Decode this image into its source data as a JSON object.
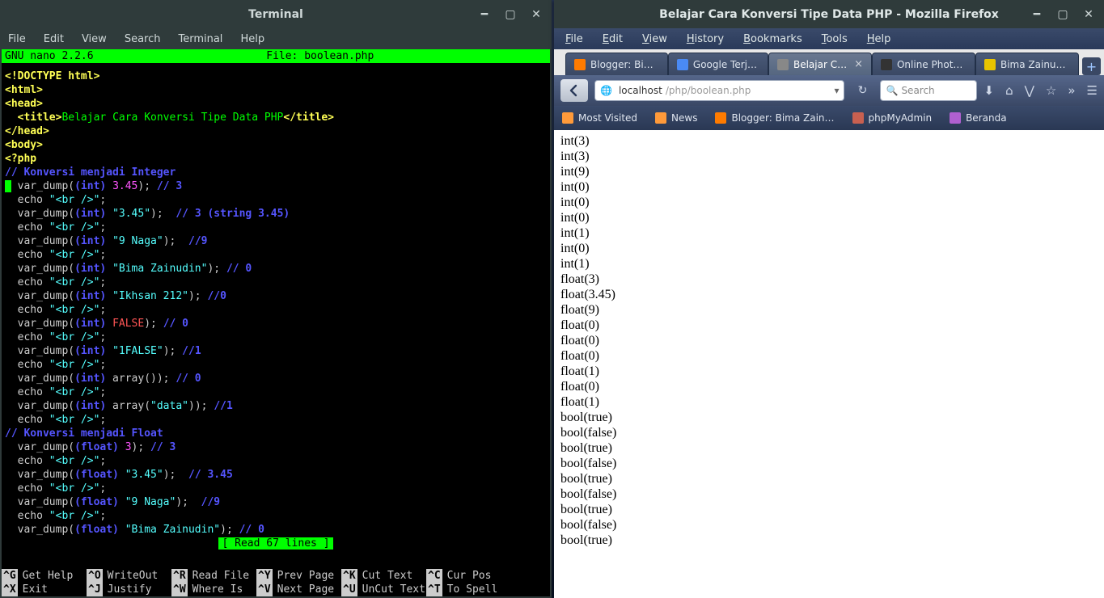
{
  "terminal": {
    "title": "Terminal",
    "menus": [
      "File",
      "Edit",
      "View",
      "Search",
      "Terminal",
      "Help"
    ],
    "nano": {
      "version": "GNU nano 2.2.6",
      "file_label": "File: boolean.php",
      "status": "[ Read 67 lines ]",
      "shortcuts_row1": [
        {
          "k": "^G",
          "l": "Get Help"
        },
        {
          "k": "^O",
          "l": "WriteOut"
        },
        {
          "k": "^R",
          "l": "Read File"
        },
        {
          "k": "^Y",
          "l": "Prev Page"
        },
        {
          "k": "^K",
          "l": "Cut Text"
        },
        {
          "k": "^C",
          "l": "Cur Pos"
        }
      ],
      "shortcuts_row2": [
        {
          "k": "^X",
          "l": "Exit"
        },
        {
          "k": "^J",
          "l": "Justify"
        },
        {
          "k": "^W",
          "l": "Where Is"
        },
        {
          "k": "^V",
          "l": "Next Page"
        },
        {
          "k": "^U",
          "l": "UnCut Text"
        },
        {
          "k": "^T",
          "l": "To Spell"
        }
      ]
    },
    "code_lines": [
      [
        {
          "c": "c-y",
          "t": "<!DOCTYPE html>"
        }
      ],
      [
        {
          "c": "c-y",
          "t": "<html>"
        }
      ],
      [
        {
          "c": "c-y",
          "t": "<head>"
        }
      ],
      [
        {
          "c": "c-w",
          "t": "  "
        },
        {
          "c": "c-y",
          "t": "<title>"
        },
        {
          "c": "c-g",
          "t": "Belajar Cara Konversi Tipe Data PHP"
        },
        {
          "c": "c-y",
          "t": "</title>"
        }
      ],
      [
        {
          "c": "c-y",
          "t": "</head>"
        }
      ],
      [
        {
          "c": "c-y",
          "t": "<body>"
        }
      ],
      [
        {
          "c": "c-y",
          "t": "<?php"
        }
      ],
      [
        {
          "c": "c-c",
          "t": "// Konversi menjadi Integer"
        }
      ],
      [
        {
          "c": "cur",
          "t": " "
        },
        {
          "c": "c-w",
          "t": " var_dump("
        },
        {
          "c": "c-c",
          "t": "(int)"
        },
        {
          "c": "c-w",
          "t": " "
        },
        {
          "c": "c-m",
          "t": "3.45"
        },
        {
          "c": "c-w",
          "t": "); "
        },
        {
          "c": "c-c",
          "t": "// 3"
        }
      ],
      [
        {
          "c": "c-w",
          "t": "  echo "
        },
        {
          "c": "c-cy",
          "t": "\"<br />\""
        },
        {
          "c": "c-w",
          "t": ";"
        }
      ],
      [
        {
          "c": "c-w",
          "t": "  var_dump("
        },
        {
          "c": "c-c",
          "t": "(int)"
        },
        {
          "c": "c-w",
          "t": " "
        },
        {
          "c": "c-cy",
          "t": "\"3.45\""
        },
        {
          "c": "c-w",
          "t": ");  "
        },
        {
          "c": "c-c",
          "t": "// 3 (string 3.45)"
        }
      ],
      [
        {
          "c": "c-w",
          "t": "  echo "
        },
        {
          "c": "c-cy",
          "t": "\"<br />\""
        },
        {
          "c": "c-w",
          "t": ";"
        }
      ],
      [
        {
          "c": "c-w",
          "t": "  var_dump("
        },
        {
          "c": "c-c",
          "t": "(int)"
        },
        {
          "c": "c-w",
          "t": " "
        },
        {
          "c": "c-cy",
          "t": "\"9 Naga\""
        },
        {
          "c": "c-w",
          "t": ");  "
        },
        {
          "c": "c-c",
          "t": "//9"
        }
      ],
      [
        {
          "c": "c-w",
          "t": "  echo "
        },
        {
          "c": "c-cy",
          "t": "\"<br />\""
        },
        {
          "c": "c-w",
          "t": ";"
        }
      ],
      [
        {
          "c": "c-w",
          "t": "  var_dump("
        },
        {
          "c": "c-c",
          "t": "(int)"
        },
        {
          "c": "c-w",
          "t": " "
        },
        {
          "c": "c-cy",
          "t": "\"Bima Zainudin\""
        },
        {
          "c": "c-w",
          "t": "); "
        },
        {
          "c": "c-c",
          "t": "// 0"
        }
      ],
      [
        {
          "c": "c-w",
          "t": "  echo "
        },
        {
          "c": "c-cy",
          "t": "\"<br />\""
        },
        {
          "c": "c-w",
          "t": ";"
        }
      ],
      [
        {
          "c": "c-w",
          "t": "  var_dump("
        },
        {
          "c": "c-c",
          "t": "(int)"
        },
        {
          "c": "c-w",
          "t": " "
        },
        {
          "c": "c-cy",
          "t": "\"Ikhsan 212\""
        },
        {
          "c": "c-w",
          "t": "); "
        },
        {
          "c": "c-c",
          "t": "//0"
        }
      ],
      [
        {
          "c": "c-w",
          "t": "  echo "
        },
        {
          "c": "c-cy",
          "t": "\"<br />\""
        },
        {
          "c": "c-w",
          "t": ";"
        }
      ],
      [
        {
          "c": "c-w",
          "t": "  var_dump("
        },
        {
          "c": "c-c",
          "t": "(int)"
        },
        {
          "c": "c-w",
          "t": " "
        },
        {
          "c": "c-r",
          "t": "FALSE"
        },
        {
          "c": "c-w",
          "t": "); "
        },
        {
          "c": "c-c",
          "t": "// 0"
        }
      ],
      [
        {
          "c": "c-w",
          "t": "  echo "
        },
        {
          "c": "c-cy",
          "t": "\"<br />\""
        },
        {
          "c": "c-w",
          "t": ";"
        }
      ],
      [
        {
          "c": "c-w",
          "t": "  var_dump("
        },
        {
          "c": "c-c",
          "t": "(int)"
        },
        {
          "c": "c-w",
          "t": " "
        },
        {
          "c": "c-cy",
          "t": "\"1FALSE\""
        },
        {
          "c": "c-w",
          "t": "); "
        },
        {
          "c": "c-c",
          "t": "//1"
        }
      ],
      [
        {
          "c": "c-w",
          "t": "  echo "
        },
        {
          "c": "c-cy",
          "t": "\"<br />\""
        },
        {
          "c": "c-w",
          "t": ";"
        }
      ],
      [
        {
          "c": "c-w",
          "t": "  var_dump("
        },
        {
          "c": "c-c",
          "t": "(int)"
        },
        {
          "c": "c-w",
          "t": " array()); "
        },
        {
          "c": "c-c",
          "t": "// 0"
        }
      ],
      [
        {
          "c": "c-w",
          "t": "  echo "
        },
        {
          "c": "c-cy",
          "t": "\"<br />\""
        },
        {
          "c": "c-w",
          "t": ";"
        }
      ],
      [
        {
          "c": "c-w",
          "t": "  var_dump("
        },
        {
          "c": "c-c",
          "t": "(int)"
        },
        {
          "c": "c-w",
          "t": " array("
        },
        {
          "c": "c-cy",
          "t": "\"data\""
        },
        {
          "c": "c-w",
          "t": ")); "
        },
        {
          "c": "c-c",
          "t": "//1"
        }
      ],
      [
        {
          "c": "c-w",
          "t": "  echo "
        },
        {
          "c": "c-cy",
          "t": "\"<br />\""
        },
        {
          "c": "c-w",
          "t": ";"
        }
      ],
      [
        {
          "c": "c-c",
          "t": "// Konversi menjadi Float"
        }
      ],
      [
        {
          "c": "c-w",
          "t": "  var_dump("
        },
        {
          "c": "c-c",
          "t": "(float)"
        },
        {
          "c": "c-w",
          "t": " "
        },
        {
          "c": "c-m",
          "t": "3"
        },
        {
          "c": "c-w",
          "t": "); "
        },
        {
          "c": "c-c",
          "t": "// 3"
        }
      ],
      [
        {
          "c": "c-w",
          "t": "  echo "
        },
        {
          "c": "c-cy",
          "t": "\"<br />\""
        },
        {
          "c": "c-w",
          "t": ";"
        }
      ],
      [
        {
          "c": "c-w",
          "t": "  var_dump("
        },
        {
          "c": "c-c",
          "t": "(float)"
        },
        {
          "c": "c-w",
          "t": " "
        },
        {
          "c": "c-cy",
          "t": "\"3.45\""
        },
        {
          "c": "c-w",
          "t": ");  "
        },
        {
          "c": "c-c",
          "t": "// 3.45"
        }
      ],
      [
        {
          "c": "c-w",
          "t": "  echo "
        },
        {
          "c": "c-cy",
          "t": "\"<br />\""
        },
        {
          "c": "c-w",
          "t": ";"
        }
      ],
      [
        {
          "c": "c-w",
          "t": "  var_dump("
        },
        {
          "c": "c-c",
          "t": "(float)"
        },
        {
          "c": "c-w",
          "t": " "
        },
        {
          "c": "c-cy",
          "t": "\"9 Naga\""
        },
        {
          "c": "c-w",
          "t": ");  "
        },
        {
          "c": "c-c",
          "t": "//9"
        }
      ],
      [
        {
          "c": "c-w",
          "t": "  echo "
        },
        {
          "c": "c-cy",
          "t": "\"<br />\""
        },
        {
          "c": "c-w",
          "t": ";"
        }
      ],
      [
        {
          "c": "c-w",
          "t": "  var_dump("
        },
        {
          "c": "c-c",
          "t": "(float)"
        },
        {
          "c": "c-w",
          "t": " "
        },
        {
          "c": "c-cy",
          "t": "\"Bima Zainudin\""
        },
        {
          "c": "c-w",
          "t": "); "
        },
        {
          "c": "c-c",
          "t": "// 0"
        }
      ]
    ]
  },
  "firefox": {
    "title": "Belajar Cara Konversi Tipe Data PHP - Mozilla Firefox",
    "menus": [
      "File",
      "Edit",
      "View",
      "History",
      "Bookmarks",
      "Tools",
      "Help"
    ],
    "tabs": [
      {
        "label": "Blogger: Bim…",
        "color": "#ff7b00",
        "active": false
      },
      {
        "label": "Google Terje…",
        "color": "#4a8af4",
        "active": false
      },
      {
        "label": "Belajar Cara …",
        "color": "#888",
        "active": true,
        "close": true
      },
      {
        "label": "Online Photo Edi…",
        "color": "#333",
        "active": false
      },
      {
        "label": "Bima Zainudi…",
        "color": "#e8c400",
        "active": false
      }
    ],
    "url_host": "localhost",
    "url_path": "/php/boolean.php",
    "search_placeholder": "Search",
    "bookmarks": [
      {
        "label": "Most Visited",
        "color": "#ff9a3a"
      },
      {
        "label": "News",
        "color": "#ff9a3a"
      },
      {
        "label": "Blogger: Bima Zain…",
        "color": "#ff7b00"
      },
      {
        "label": "phpMyAdmin",
        "color": "#c86050"
      },
      {
        "label": "Beranda",
        "color": "#b060d0"
      }
    ],
    "page_lines": [
      "int(3)",
      "int(3)",
      "int(9)",
      "int(0)",
      "int(0)",
      "int(0)",
      "int(1)",
      "int(0)",
      "int(1)",
      "float(3)",
      "float(3.45)",
      "float(9)",
      "float(0)",
      "float(0)",
      "float(0)",
      "float(1)",
      "float(0)",
      "float(1)",
      "bool(true)",
      "bool(false)",
      "bool(true)",
      "bool(false)",
      "bool(true)",
      "bool(false)",
      "bool(true)",
      "bool(false)",
      "bool(true)"
    ]
  }
}
